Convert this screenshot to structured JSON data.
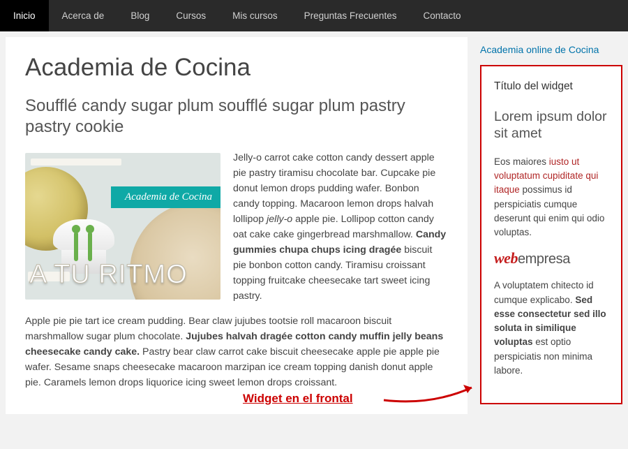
{
  "nav": {
    "items": [
      {
        "label": "Inicio",
        "active": true
      },
      {
        "label": "Acerca de",
        "active": false
      },
      {
        "label": "Blog",
        "active": false
      },
      {
        "label": "Cursos",
        "active": false
      },
      {
        "label": "Mis cursos",
        "active": false
      },
      {
        "label": "Preguntas Frecuentes",
        "active": false
      },
      {
        "label": "Contacto",
        "active": false
      }
    ]
  },
  "main": {
    "title": "Academia de Cocina",
    "subtitle": "Soufflé candy sugar plum soufflé sugar plum pastry pastry cookie",
    "image_banner": "Academia de Cocina",
    "image_caption": "A TU RITMO",
    "para1_a": "Jelly-o carrot cake cotton candy dessert apple pie pastry tiramisu chocolate bar. Cupcake pie donut lemon drops pudding wafer. Bonbon candy topping. Macaroon lemon drops halvah lollipop ",
    "para1_em": "jelly-o",
    "para1_b": " apple pie. Lollipop cotton candy oat cake cake gingerbread marshmallow. ",
    "para1_strong": "Candy gummies chupa chups icing dragée",
    "para1_c": " biscuit pie bonbon cotton candy. Tiramisu croissant topping fruitcake cheesecake tart sweet icing pastry.",
    "para2_a": "Apple pie pie tart ice cream pudding. Bear claw jujubes tootsie roll macaroon biscuit marshmallow sugar plum chocolate. ",
    "para2_strong": "Jujubes halvah dragée cotton candy muffin jelly beans cheesecake candy cake.",
    "para2_b": " Pastry bear claw carrot cake biscuit cheesecake apple pie apple pie wafer. Sesame snaps cheesecake macaroon marzipan ice cream topping danish donut apple pie. Caramels lemon drops liquorice icing sweet lemon drops croissant."
  },
  "annotation": {
    "label": "Widget en el frontal"
  },
  "sidebar": {
    "top_link": "Academia online de Cocina",
    "widget": {
      "title": "Título del widget",
      "heading": "Lorem ipsum dolor sit amet",
      "p1_a": "Eos maiores ",
      "p1_red": "iusto ut voluptatum cupiditate qui itaque",
      "p1_b": " possimus id perspiciatis cumque deserunt qui enim qui odio voluptas.",
      "logo_brand_a": "web",
      "logo_brand_b": "empresa",
      "p2_a": "A voluptatem chitecto id cumque explicabo. ",
      "p2_strong": "Sed esse consectetur sed illo soluta in similique voluptas",
      "p2_b": " est optio perspiciatis non minima labore."
    }
  }
}
